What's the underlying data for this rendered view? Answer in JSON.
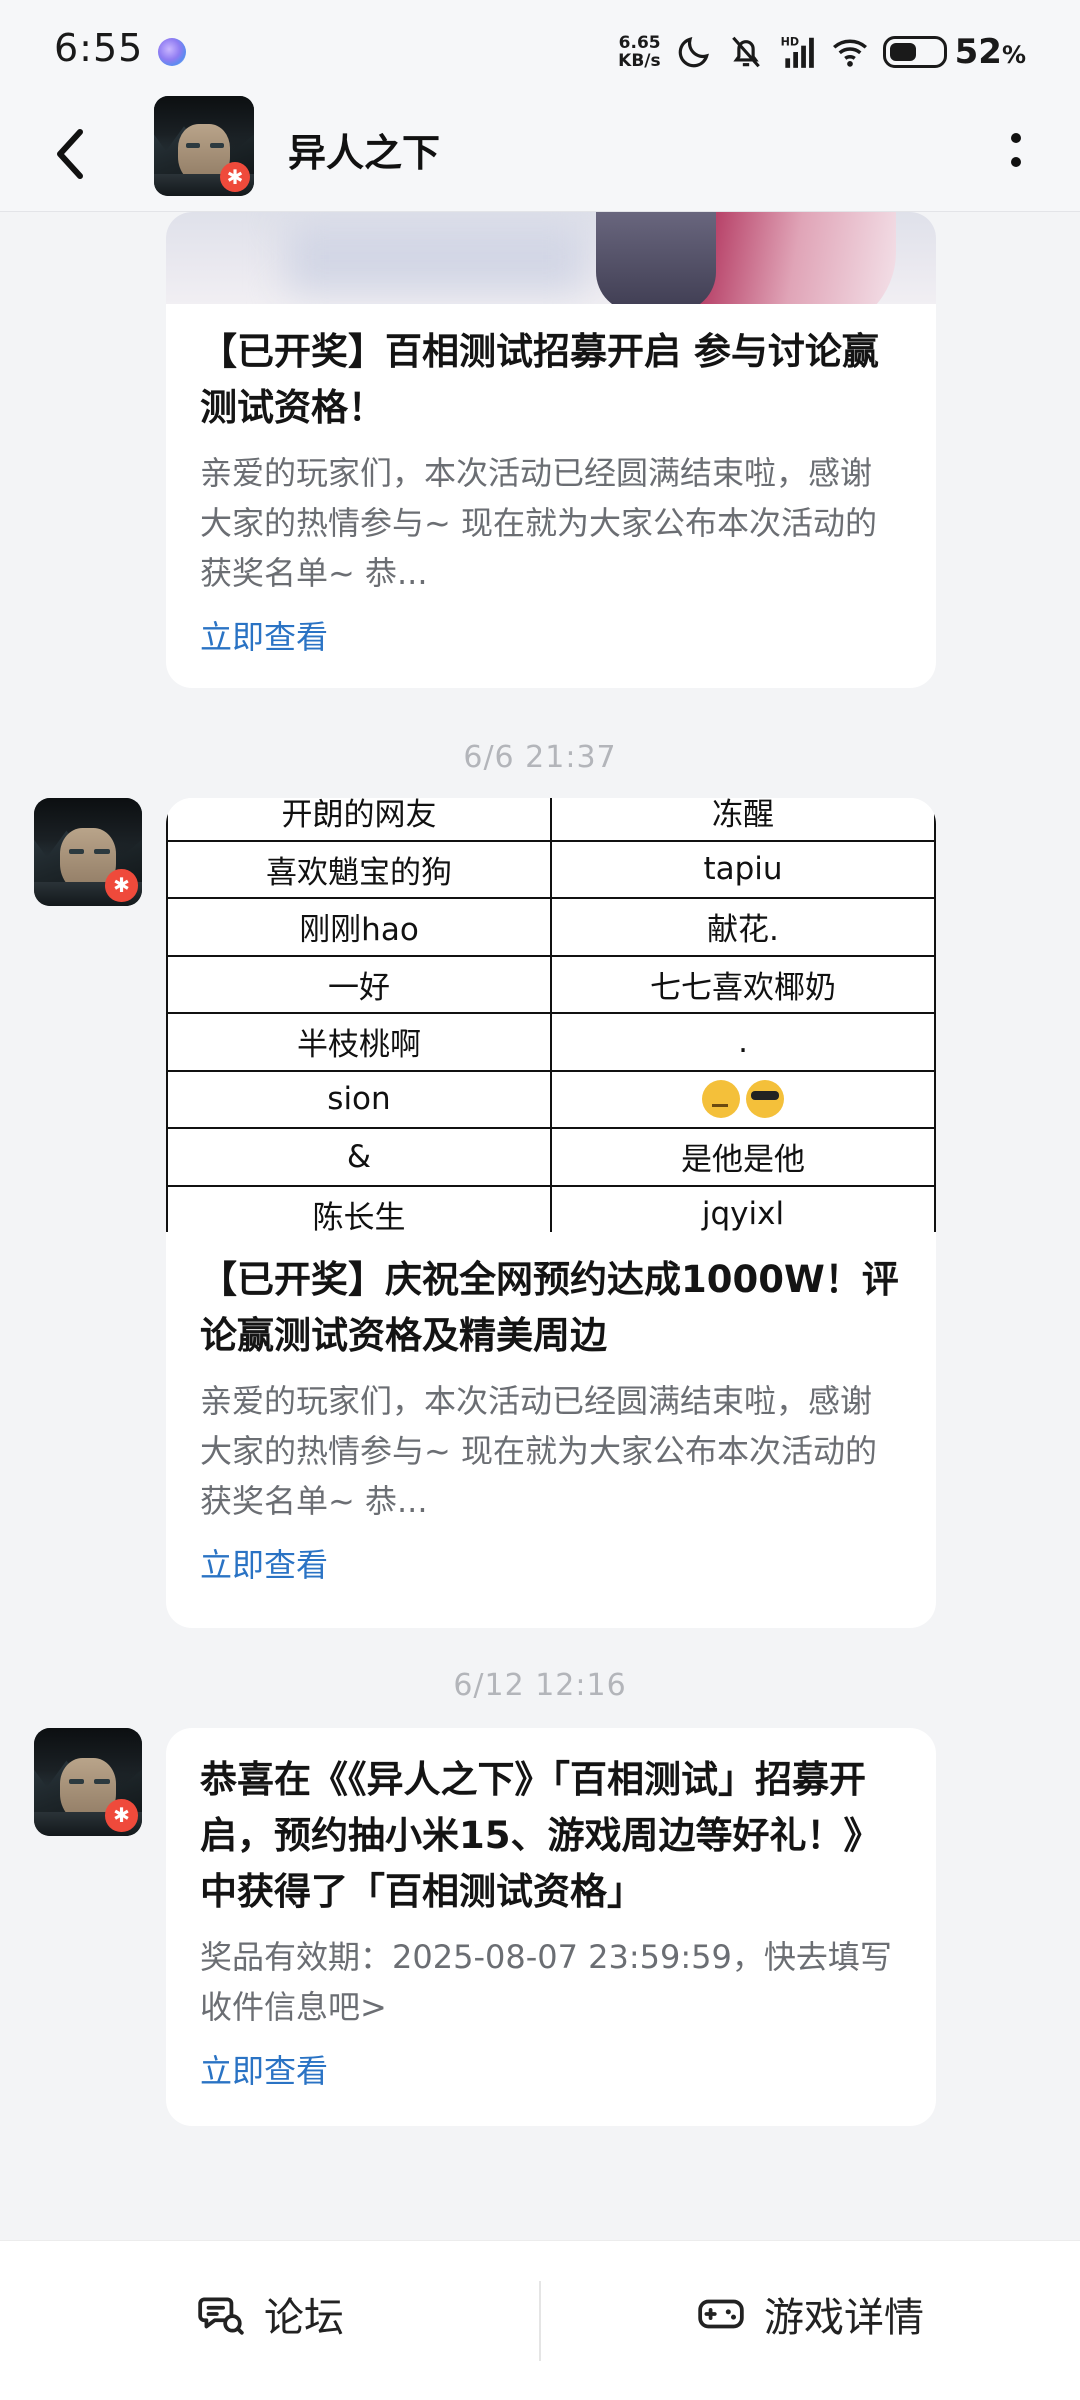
{
  "status_bar": {
    "time": "6:55",
    "net_speed_value": "6.65",
    "net_speed_unit": "KB/s",
    "battery_percent": "52",
    "battery_level": 0.52,
    "battery_suffix": "%",
    "icons": [
      "moon-icon",
      "bell-off-icon",
      "hd-signal-icon",
      "wifi-icon",
      "battery-icon"
    ]
  },
  "header": {
    "title": "异人之下",
    "back_icon": "back-arrow-icon",
    "more_icon": "more-vertical-icon"
  },
  "messages": [
    {
      "title": "【已开奖】百相测试招募开启 参与讨论赢测试资格！",
      "desc": "亲爱的玩家们，本次活动已经圆满结束啦，感谢大家的热情参与~ 现在就为大家公布本次活动的获奖名单~ 恭...",
      "link": "立即查看"
    },
    {
      "timestamp": "6/6  21:37",
      "table_rows": [
        [
          "开朗的网友",
          "冻醒"
        ],
        [
          "喜欢魈宝的狗",
          "tapiu"
        ],
        [
          "刚刚hao",
          "献花."
        ],
        [
          "一好",
          "七七喜欢椰奶"
        ],
        [
          "半枝桃啊",
          "."
        ],
        [
          "sion",
          ""
        ],
        [
          "&",
          "是他是他"
        ],
        [
          "陈长生",
          "jqyixl"
        ]
      ],
      "title": "【已开奖】庆祝全网预约达成1000W！评论赢测试资格及精美周边",
      "desc": "亲爱的玩家们，本次活动已经圆满结束啦，感谢大家的热情参与~ 现在就为大家公布本次活动的获奖名单~ 恭...",
      "link": "立即查看"
    },
    {
      "timestamp": "6/12  12:16",
      "title": "恭喜在《《异人之下》「百相测试」招募开启，预约抽小米15、游戏周边等好礼！》中获得了「百相测试资格」",
      "desc": "奖品有效期：2025-08-07 23:59:59，快去填写收件信息吧>",
      "link": "立即查看"
    }
  ],
  "tabbar": {
    "forum_label": "论坛",
    "forum_icon": "forum-chat-icon",
    "game_label": "游戏详情",
    "game_icon": "gamepad-icon"
  },
  "colors": {
    "link": "#2a73c4",
    "background": "#f3f4f6",
    "card": "#ffffff",
    "timestamp": "#b3b5ba"
  }
}
